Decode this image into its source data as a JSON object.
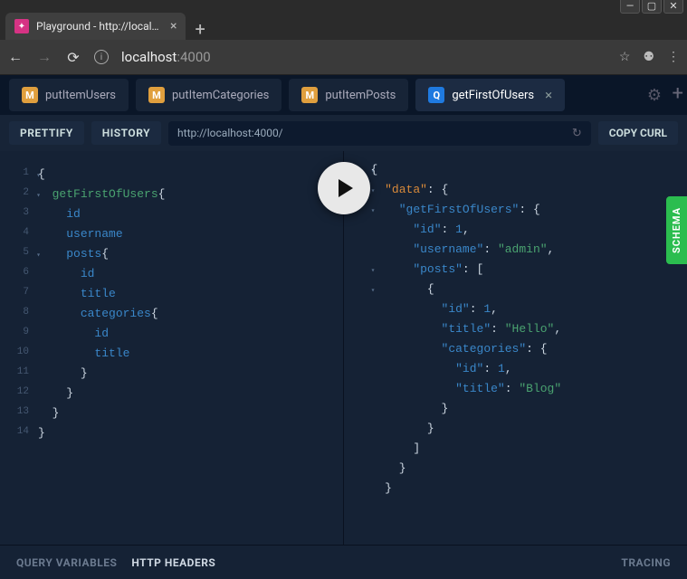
{
  "browser": {
    "page_title": "Playground - http://localhost:40…",
    "url_host": "localhost",
    "url_port": ":4000"
  },
  "pg_tabs": [
    {
      "type": "M",
      "label": "putItemUsers"
    },
    {
      "type": "M",
      "label": "putItemCategories"
    },
    {
      "type": "M",
      "label": "putItemPosts"
    },
    {
      "type": "Q",
      "label": "getFirstOfUsers"
    }
  ],
  "toolbar": {
    "prettify": "PRETTIFY",
    "history": "HISTORY",
    "endpoint": "http://localhost:4000/",
    "copycurl": "COPY CURL"
  },
  "schema_label": "SCHEMA",
  "footer": {
    "qv": "QUERY VARIABLES",
    "hh": "HTTP HEADERS",
    "tr": "TRACING"
  },
  "query": {
    "fn": "getFirstOfUsers",
    "fields": [
      "id",
      "username"
    ],
    "posts_fields": [
      "id",
      "title"
    ],
    "cat_fields": [
      "id",
      "title"
    ]
  },
  "result": {
    "data_key": "\"data\"",
    "get_key": "\"getFirstOfUsers\"",
    "id_key": "\"id\"",
    "username_key": "\"username\"",
    "posts_key": "\"posts\"",
    "title_key": "\"title\"",
    "categories_key": "\"categories\"",
    "id_val": "1",
    "username_val": "\"admin\"",
    "post_id_val": "1",
    "post_title_val": "\"Hello\"",
    "cat_id_val": "1",
    "cat_title_val": "\"Blog\""
  }
}
